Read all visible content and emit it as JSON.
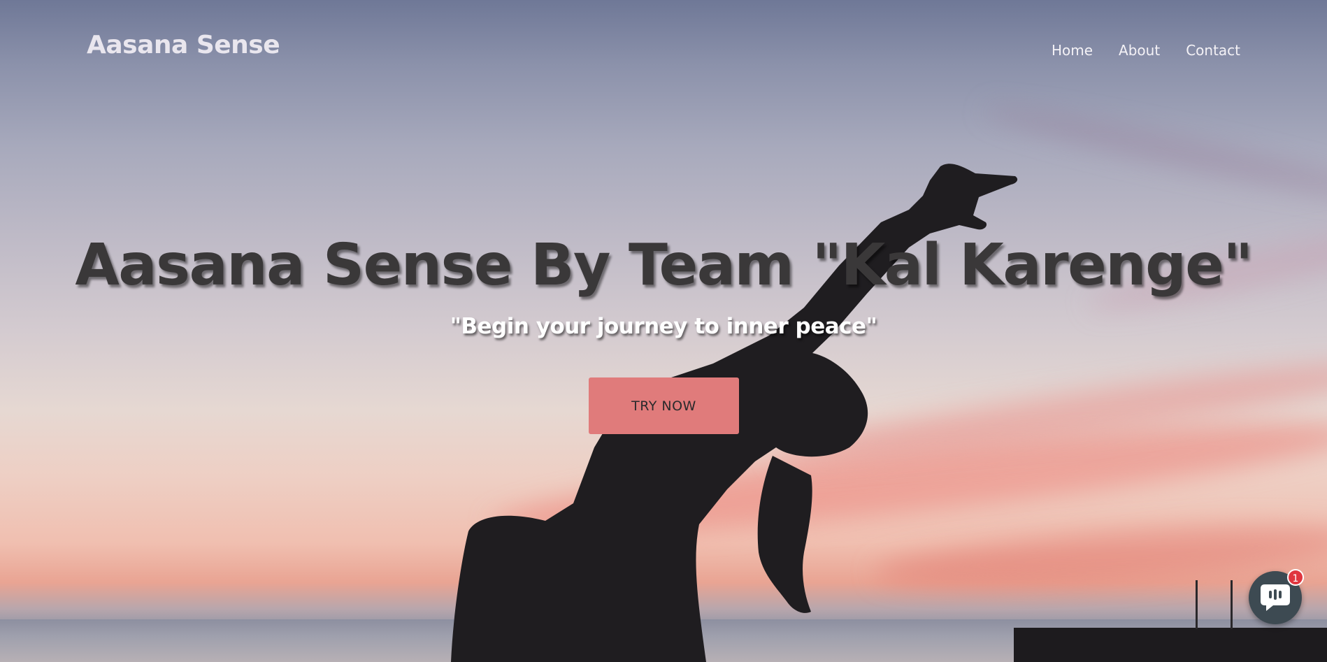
{
  "nav": {
    "brand": "Aasana Sense",
    "links": [
      {
        "label": "Home"
      },
      {
        "label": "About"
      },
      {
        "label": "Contact"
      }
    ]
  },
  "hero": {
    "title": "Aasana Sense By Team \"Kal Karenge\"",
    "tagline": "\"Begin your journey to inner peace\"",
    "cta_label": "TRY NOW",
    "background": "sunset-yoga-silhouette"
  },
  "chat": {
    "icon": "chat-bubble-icon",
    "badge_count": "1"
  },
  "colors": {
    "cta_background": "#e07b7b",
    "headline_text": "#3a3839",
    "chat_button": "#3d4a52",
    "badge": "#e0363f"
  }
}
